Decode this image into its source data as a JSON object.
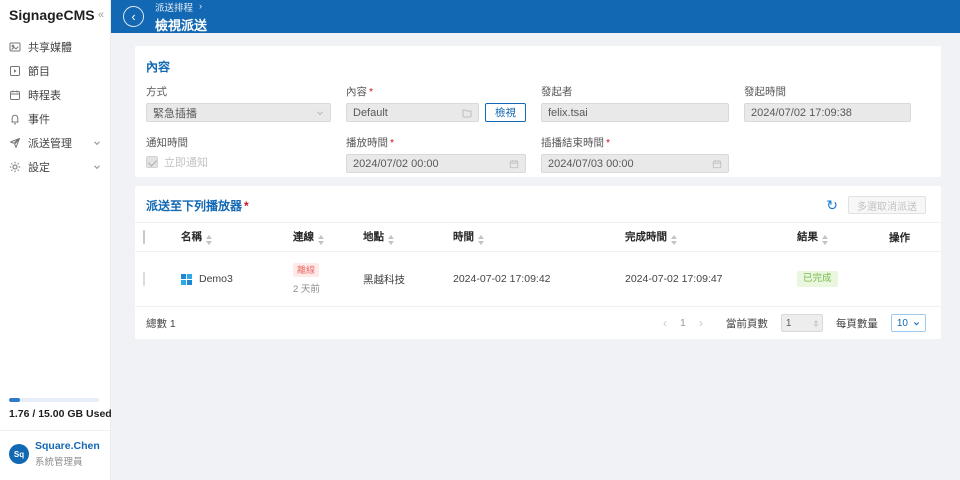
{
  "app": {
    "title": "SignageCMS"
  },
  "icons": {
    "collapse": "«",
    "back": "‹",
    "breadcrumb_sep": "›",
    "refresh": "↻",
    "prev": "‹",
    "next": "›"
  },
  "colors": {
    "accent": "#1268b3",
    "offline_red": "#ee7069",
    "success_green": "#79bb50"
  },
  "sidebar": {
    "items": [
      {
        "label": "共享媒體",
        "icon": "media-icon"
      },
      {
        "label": "節目",
        "icon": "program-icon"
      },
      {
        "label": "時程表",
        "icon": "schedule-icon"
      },
      {
        "label": "事件",
        "icon": "event-icon"
      },
      {
        "label": "派送管理",
        "icon": "dispatch-icon",
        "expandable": true
      },
      {
        "label": "設定",
        "icon": "settings-icon",
        "expandable": true
      }
    ],
    "storage": {
      "used_label": "1.76 / 15.00 GB Used",
      "percent": 12
    },
    "user": {
      "initials": "Sq",
      "name": "Square.Chen",
      "role": "系統管理員"
    }
  },
  "header": {
    "breadcrumb": "派送排程",
    "title": "檢視派送"
  },
  "content_card": {
    "section_title": "內容",
    "fields": {
      "method": {
        "label": "方式",
        "value": "緊急插播"
      },
      "content": {
        "label": "內容",
        "required": "*",
        "value": "Default",
        "view_button": "檢視"
      },
      "initiator": {
        "label": "發起者",
        "value": "felix.tsai"
      },
      "start_time": {
        "label": "發起時間",
        "value": "2024/07/02 17:09:38"
      },
      "notify": {
        "label": "通知時間",
        "checkbox_label": "立即通知"
      },
      "play_time": {
        "label": "播放時間",
        "required": "*",
        "value": "2024/07/02 00:00"
      },
      "end_time": {
        "label": "插播結束時間",
        "required": "*",
        "value": "2024/07/03 00:00"
      }
    }
  },
  "players_card": {
    "section_title": "派送至下列播放器",
    "required": "*",
    "cancel_button": "多選取消派送",
    "table": {
      "headers": [
        "名稱",
        "連線",
        "地點",
        "時間",
        "完成時間",
        "結果",
        "操作"
      ],
      "rows": [
        {
          "name": "Demo3",
          "connection_status": "離線",
          "last_seen": "2 天前",
          "location": "黑越科技",
          "time": "2024-07-02 17:09:42",
          "finish_time": "2024-07-02 17:09:47",
          "result": "已完成"
        }
      ]
    },
    "footer": {
      "total_label": "總數 1",
      "page": "1",
      "current_page_label": "當前頁數",
      "current_page_value": "1",
      "page_size_label": "每頁數量",
      "page_size_value": "10"
    }
  }
}
